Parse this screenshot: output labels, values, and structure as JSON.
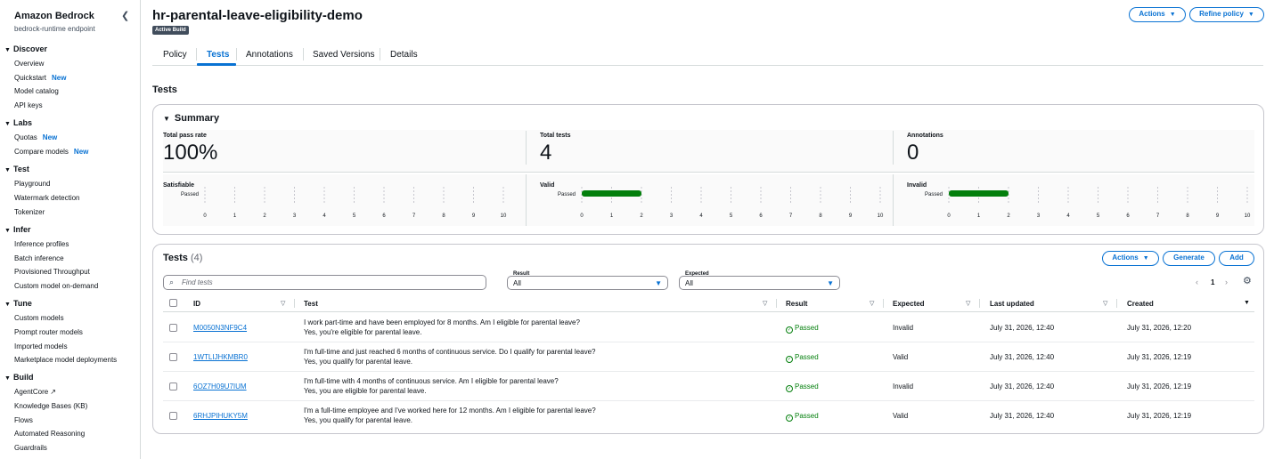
{
  "sidebar": {
    "brand": "Amazon Bedrock",
    "brand_sub": "bedrock-runtime endpoint",
    "collapse_icon": "chevron-left",
    "sections": [
      {
        "label": "Discover",
        "items": [
          {
            "label": "Overview"
          },
          {
            "label": "Quickstart",
            "badge": "New"
          },
          {
            "label": "Model catalog"
          },
          {
            "label": "API keys"
          }
        ]
      },
      {
        "label": "Labs",
        "items": [
          {
            "label": "Quotas",
            "badge": "New"
          },
          {
            "label": "Compare models",
            "badge": "New"
          }
        ]
      },
      {
        "label": "Test",
        "items": [
          {
            "label": "Playground"
          },
          {
            "label": "Watermark detection"
          },
          {
            "label": "Tokenizer"
          }
        ]
      },
      {
        "label": "Infer",
        "items": [
          {
            "label": "Inference profiles"
          },
          {
            "label": "Batch inference"
          },
          {
            "label": "Provisioned Throughput"
          },
          {
            "label": "Custom model on-demand"
          }
        ]
      },
      {
        "label": "Tune",
        "items": [
          {
            "label": "Custom models"
          },
          {
            "label": "Prompt router models"
          },
          {
            "label": "Imported models"
          },
          {
            "label": "Marketplace model deployments"
          }
        ]
      },
      {
        "label": "Build",
        "items": [
          {
            "label": "AgentCore",
            "external": true
          },
          {
            "label": "Knowledge Bases (KB)"
          },
          {
            "label": "Flows"
          },
          {
            "label": "Automated Reasoning"
          },
          {
            "label": "Guardrails"
          }
        ]
      }
    ]
  },
  "header": {
    "title": "hr-parental-leave-eligibility-demo",
    "badge": "Active Build",
    "actions_label": "Actions",
    "refine_label": "Refine policy"
  },
  "tabs": [
    {
      "label": "Policy"
    },
    {
      "label": "Tests",
      "active": true
    },
    {
      "label": "Annotations"
    },
    {
      "label": "Saved Versions"
    },
    {
      "label": "Details"
    }
  ],
  "section_title": "Tests",
  "summary": {
    "title": "Summary",
    "metrics": [
      {
        "label": "Total pass rate",
        "value": "100%"
      },
      {
        "label": "Total tests",
        "value": "4"
      },
      {
        "label": "Annotations",
        "value": "0"
      }
    ],
    "charts": [
      {
        "title": "Satisfiable",
        "bar_label": "Passed",
        "value": 0,
        "ticks": [
          "0",
          "1",
          "2",
          "3",
          "4",
          "5",
          "6",
          "7",
          "8",
          "9",
          "10"
        ]
      },
      {
        "title": "Valid",
        "bar_label": "Passed",
        "value": 2,
        "ticks": [
          "0",
          "1",
          "2",
          "3",
          "4",
          "5",
          "6",
          "7",
          "8",
          "9",
          "10"
        ]
      },
      {
        "title": "Invalid",
        "bar_label": "Passed",
        "value": 2,
        "ticks": [
          "0",
          "1",
          "2",
          "3",
          "4",
          "5",
          "6",
          "7",
          "8",
          "9",
          "10"
        ]
      }
    ],
    "bar_color": "#037f0c"
  },
  "tests_table": {
    "title": "Tests",
    "count": "(4)",
    "actions_label": "Actions",
    "generate_label": "Generate",
    "add_label": "Add",
    "search_placeholder": "Find tests",
    "filter_result_label": "Result",
    "filter_result_value": "All",
    "filter_expected_label": "Expected",
    "filter_expected_value": "All",
    "page": "1",
    "columns": [
      "ID",
      "Test",
      "Result",
      "Expected",
      "Last updated",
      "Created"
    ],
    "rows": [
      {
        "id": "M0050N3NF9C4",
        "question": "I work part-time and have been employed for 8 months. Am I eligible for parental leave?",
        "answer": "Yes, you're eligible for parental leave.",
        "result": "Passed",
        "expected": "Invalid",
        "updated": "July 31, 2026, 12:40",
        "created": "July 31, 2026, 12:20"
      },
      {
        "id": "1WTLIJHKMBR0",
        "question": "I'm full-time and just reached 6 months of continuous service. Do I qualify for parental leave?",
        "answer": "Yes, you qualify for parental leave.",
        "result": "Passed",
        "expected": "Valid",
        "updated": "July 31, 2026, 12:40",
        "created": "July 31, 2026, 12:19"
      },
      {
        "id": "6OZ7H09U7IUM",
        "question": "I'm full-time with 4 months of continuous service. Am I eligible for parental leave?",
        "answer": "Yes, you are eligible for parental leave.",
        "result": "Passed",
        "expected": "Invalid",
        "updated": "July 31, 2026, 12:40",
        "created": "July 31, 2026, 12:19"
      },
      {
        "id": "6RHJPIHUKY5M",
        "question": "I'm a full-time employee and I've worked here for 12 months. Am I eligible for parental leave?",
        "answer": "Yes, you qualify for parental leave.",
        "result": "Passed",
        "expected": "Valid",
        "updated": "July 31, 2026, 12:40",
        "created": "July 31, 2026, 12:19"
      }
    ]
  }
}
